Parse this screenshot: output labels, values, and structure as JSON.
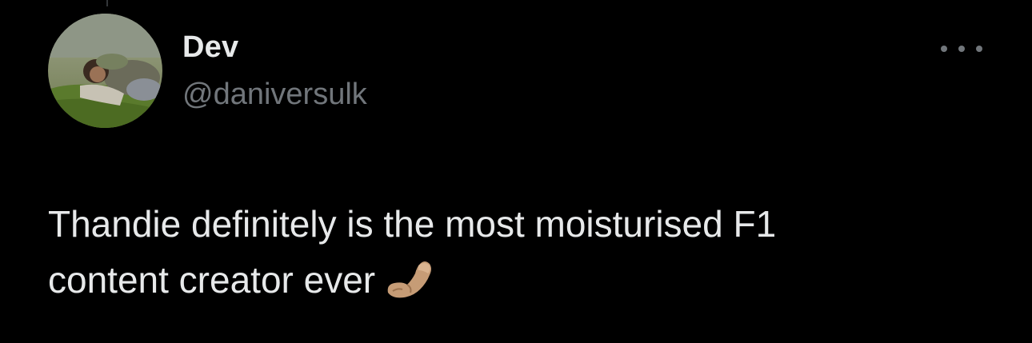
{
  "tweet": {
    "author_name": "Dev",
    "author_handle": "@daniversulk",
    "text_lines": [
      "Thandie definitely is the most moisturised F1",
      "content creator ever"
    ],
    "emoji": "pinched-fingers-emoji",
    "more_icon": "more-horizontal-icon"
  },
  "colors": {
    "background": "#000000",
    "primary_text": "#e7e9ea",
    "secondary_text": "#71767b"
  }
}
